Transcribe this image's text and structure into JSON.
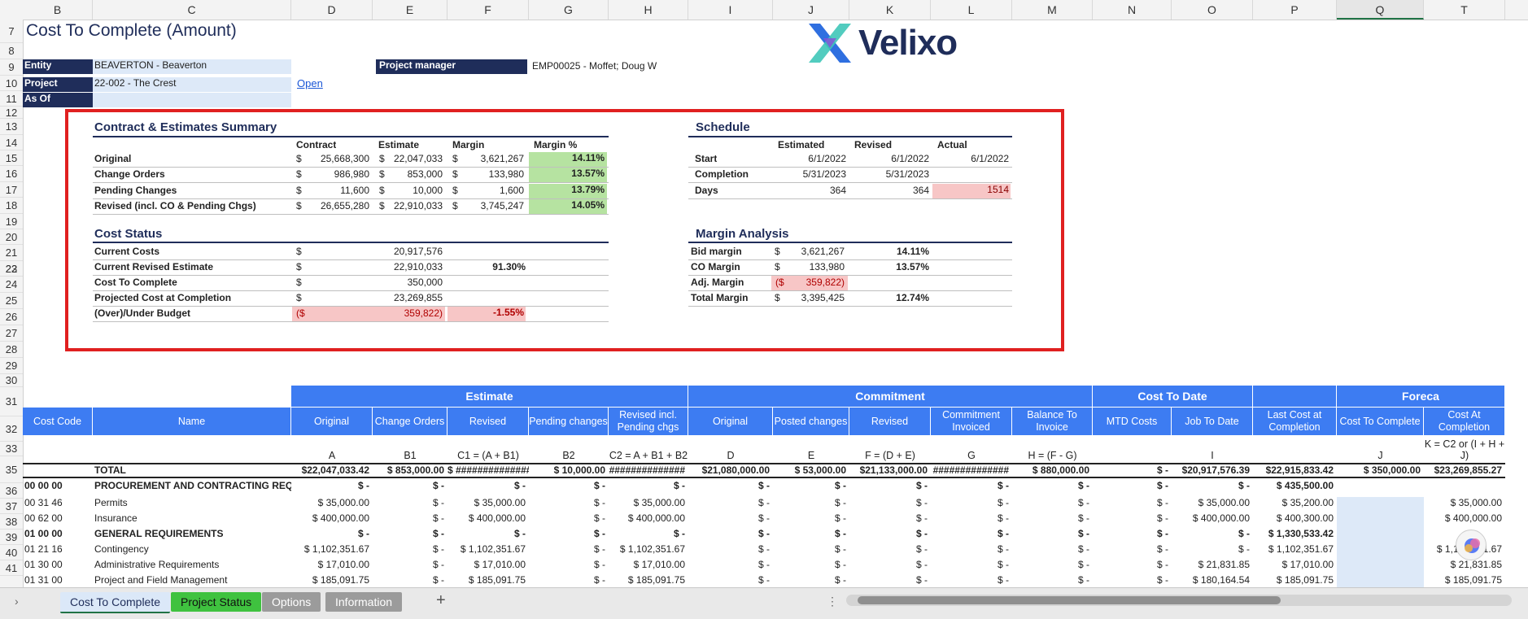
{
  "columns": [
    "B",
    "C",
    "D",
    "E",
    "F",
    "G",
    "H",
    "I",
    "J",
    "K",
    "L",
    "M",
    "N",
    "O",
    "P",
    "Q",
    "T"
  ],
  "rows": [
    "7",
    "8",
    "9",
    "10",
    "11",
    "12",
    "13",
    "14",
    "15",
    "16",
    "17",
    "18",
    "19",
    "20",
    "21",
    "22",
    "23",
    "24",
    "25",
    "26",
    "27",
    "28",
    "29",
    "30",
    "31",
    "32",
    "33",
    "35",
    "36",
    "37",
    "38",
    "39",
    "40",
    "41"
  ],
  "title": "Cost To Complete (Amount)",
  "logo_text": "Velixo",
  "header": {
    "entity_label": "Entity",
    "entity_value": "BEAVERTON - Beaverton",
    "project_label": "Project",
    "project_value": "22-002 - The Crest",
    "asof_label": "As Of",
    "open_link": "Open",
    "pm_label": "Project manager",
    "pm_value": "EMP00025 - Moffet; Doug W"
  },
  "summary": {
    "title": "Contract & Estimates Summary",
    "cols": [
      "Contract",
      "Estimate",
      "Margin",
      "Margin %"
    ],
    "rows": [
      {
        "label": "Original",
        "contract": "25,668,300",
        "estimate": "22,047,033",
        "margin": "3,621,267",
        "pct": "14.11%"
      },
      {
        "label": "Change Orders",
        "contract": "986,980",
        "estimate": "853,000",
        "margin": "133,980",
        "pct": "13.57%"
      },
      {
        "label": "Pending Changes",
        "contract": "11,600",
        "estimate": "10,000",
        "margin": "1,600",
        "pct": "13.79%"
      },
      {
        "label": "Revised (incl. CO & Pending Chgs)",
        "contract": "26,655,280",
        "estimate": "22,910,033",
        "margin": "3,745,247",
        "pct": "14.05%"
      }
    ]
  },
  "cost_status": {
    "title": "Cost Status",
    "rows": [
      {
        "label": "Current Costs",
        "value": "20,917,576",
        "pct": ""
      },
      {
        "label": "Current Revised Estimate",
        "value": "22,910,033",
        "pct": "91.30%"
      },
      {
        "label": "Cost To Complete",
        "value": "350,000",
        "pct": ""
      },
      {
        "label": "Projected Cost at Completion",
        "value": "23,269,855",
        "pct": ""
      },
      {
        "label": "(Over)/Under Budget",
        "value": "359,822)",
        "pct": "-1.55%"
      }
    ]
  },
  "schedule": {
    "title": "Schedule",
    "cols": [
      "Estimated",
      "Revised",
      "Actual"
    ],
    "rows": [
      {
        "label": "Start",
        "est": "6/1/2022",
        "rev": "6/1/2022",
        "act": "6/1/2022"
      },
      {
        "label": "Completion",
        "est": "5/31/2023",
        "rev": "5/31/2023",
        "act": ""
      },
      {
        "label": "Days",
        "est": "364",
        "rev": "364",
        "act": "1514"
      }
    ]
  },
  "margin_analysis": {
    "title": "Margin Analysis",
    "rows": [
      {
        "label": "Bid margin",
        "value": "3,621,267",
        "pct": "14.11%"
      },
      {
        "label": "CO Margin",
        "value": "133,980",
        "pct": "13.57%"
      },
      {
        "label": "Adj. Margin",
        "value": "359,822)",
        "pct": ""
      },
      {
        "label": "Total Margin",
        "value": "3,395,425",
        "pct": "12.74%"
      }
    ]
  },
  "table": {
    "groups": [
      "Estimate",
      "Commitment",
      "Cost To Date",
      "Foreca"
    ],
    "headers": [
      "Cost Code",
      "Name",
      "Original",
      "Change Orders",
      "Revised",
      "Pending changes",
      "Revised incl. Pending chgs",
      "Original",
      "Posted changes",
      "Revised",
      "Commitment Invoiced",
      "Balance To Invoice",
      "MTD Costs",
      "Job To Date",
      "Last Cost at Completion",
      "Cost To Complete",
      "Cost At Completion"
    ],
    "formulas": [
      "",
      "",
      "A",
      "B1",
      "C1 = (A + B1)",
      "B2",
      "C2 = A + B1 + B2",
      "D",
      "E",
      "F = (D + E)",
      "G",
      "H = (F - G)",
      "",
      "I",
      "",
      "J",
      "K = C2 or (I + H + J)"
    ],
    "rows": [
      {
        "code": "",
        "name": "TOTAL",
        "bold": true,
        "cells": [
          "$22,047,033.42",
          "$ 853,000.00",
          "$ ##############",
          "$ 10,000.00",
          "##############",
          "$21,080,000.00",
          "$ 53,000.00",
          "$21,133,000.00",
          "##############",
          "$ 880,000.00",
          "$ -",
          "$20,917,576.39",
          "$22,915,833.42",
          "$ 350,000.00",
          "$23,269,855.27"
        ]
      },
      {
        "code": "00 00 00",
        "name": "PROCUREMENT AND CONTRACTING REQ",
        "bold": true,
        "cells": [
          "$ -",
          "$ -",
          "$ -",
          "$ -",
          "$ -",
          "$ -",
          "$ -",
          "$ -",
          "$ -",
          "$ -",
          "$ -",
          "$ -",
          "$ 435,500.00",
          "",
          ""
        ]
      },
      {
        "code": "00 31 46",
        "name": "Permits",
        "bold": false,
        "cells": [
          "$ 35,000.00",
          "$ -",
          "$ 35,000.00",
          "$ -",
          "$ 35,000.00",
          "$ -",
          "$ -",
          "$ -",
          "$ -",
          "$ -",
          "$ -",
          "$ 35,000.00",
          "$ 35,200.00",
          "",
          "$ 35,000.00"
        ]
      },
      {
        "code": "00 62 00",
        "name": "Insurance",
        "bold": false,
        "cells": [
          "$ 400,000.00",
          "$ -",
          "$ 400,000.00",
          "$ -",
          "$ 400,000.00",
          "$ -",
          "$ -",
          "$ -",
          "$ -",
          "$ -",
          "$ -",
          "$ 400,000.00",
          "$ 400,300.00",
          "",
          "$ 400,000.00"
        ]
      },
      {
        "code": "01 00 00",
        "name": "GENERAL REQUIREMENTS",
        "bold": true,
        "cells": [
          "$ -",
          "$ -",
          "$ -",
          "$ -",
          "$ -",
          "$ -",
          "$ -",
          "$ -",
          "$ -",
          "$ -",
          "$ -",
          "$ -",
          "$ 1,330,533.42",
          "",
          ""
        ]
      },
      {
        "code": "01 21 16",
        "name": "Contingency",
        "bold": false,
        "cells": [
          "$ 1,102,351.67",
          "$ -",
          "$ 1,102,351.67",
          "$ -",
          "$ 1,102,351.67",
          "$ -",
          "$ -",
          "$ -",
          "$ -",
          "$ -",
          "$ -",
          "$ -",
          "$ 1,102,351.67",
          "",
          "$ 1,102,351.67"
        ]
      },
      {
        "code": "01 30 00",
        "name": "Administrative Requirements",
        "bold": false,
        "cells": [
          "$ 17,010.00",
          "$ -",
          "$ 17,010.00",
          "$ -",
          "$ 17,010.00",
          "$ -",
          "$ -",
          "$ -",
          "$ -",
          "$ -",
          "$ -",
          "$ 21,831.85",
          "$ 17,010.00",
          "",
          "$ 21,831.85"
        ]
      },
      {
        "code": "01 31 00",
        "name": "Project and Field Management",
        "bold": false,
        "cells": [
          "$ 185,091.75",
          "$ -",
          "$ 185,091.75",
          "$ -",
          "$ 185,091.75",
          "$ -",
          "$ -",
          "$ -",
          "$ -",
          "$ -",
          "$ -",
          "$ 180,164.54",
          "$ 185,091.75",
          "",
          "$ 185,091.75"
        ]
      }
    ]
  },
  "sheet_tabs": [
    "Cost To Complete",
    "Project Status",
    "Options",
    "Information"
  ],
  "add_sheet": "+"
}
